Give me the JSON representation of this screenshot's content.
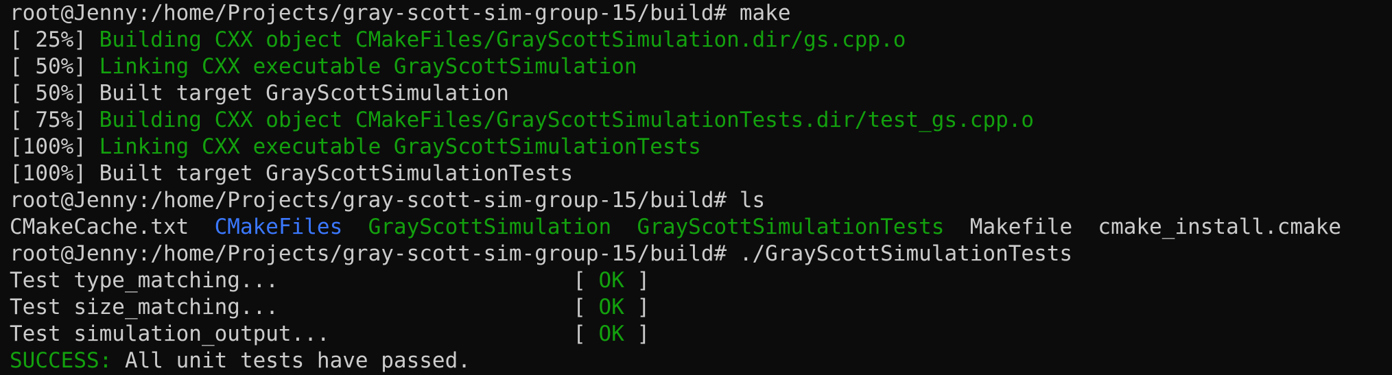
{
  "terminal": {
    "colors": {
      "background": "#0c0c0c",
      "foreground": "#cccccc",
      "green": "#13a10e",
      "blue": "#3b78ff"
    },
    "lines": [
      {
        "role": "prompt",
        "segments": [
          {
            "text": "root@Jenny:/home/Projects/gray-scott-sim-group-15/build# make",
            "color": "fg"
          }
        ]
      },
      {
        "role": "build-step",
        "segments": [
          {
            "text": "[ 25%] ",
            "color": "fg"
          },
          {
            "text": "Building CXX object CMakeFiles/GrayScottSimulation.dir/gs.cpp.o",
            "color": "green"
          }
        ]
      },
      {
        "role": "build-step",
        "segments": [
          {
            "text": "[ 50%] ",
            "color": "fg"
          },
          {
            "text": "Linking CXX executable GrayScottSimulation",
            "color": "green"
          }
        ]
      },
      {
        "role": "build-step",
        "segments": [
          {
            "text": "[ 50%] Built target GrayScottSimulation",
            "color": "fg"
          }
        ]
      },
      {
        "role": "build-step",
        "segments": [
          {
            "text": "[ 75%] ",
            "color": "fg"
          },
          {
            "text": "Building CXX object CMakeFiles/GrayScottSimulationTests.dir/test_gs.cpp.o",
            "color": "green"
          }
        ]
      },
      {
        "role": "build-step",
        "segments": [
          {
            "text": "[100%] ",
            "color": "fg"
          },
          {
            "text": "Linking CXX executable GrayScottSimulationTests",
            "color": "green"
          }
        ]
      },
      {
        "role": "build-step",
        "segments": [
          {
            "text": "[100%] Built target GrayScottSimulationTests",
            "color": "fg"
          }
        ]
      },
      {
        "role": "prompt",
        "segments": [
          {
            "text": "root@Jenny:/home/Projects/gray-scott-sim-group-15/build# ls",
            "color": "fg"
          }
        ]
      },
      {
        "role": "ls-output",
        "segments": [
          {
            "text": "CMakeCache.txt  ",
            "color": "fg"
          },
          {
            "text": "CMakeFiles",
            "color": "blue"
          },
          {
            "text": "  ",
            "color": "fg"
          },
          {
            "text": "GrayScottSimulation",
            "color": "green"
          },
          {
            "text": "  ",
            "color": "fg"
          },
          {
            "text": "GrayScottSimulationTests",
            "color": "green"
          },
          {
            "text": "  Makefile  cmake_install.cmake",
            "color": "fg"
          }
        ]
      },
      {
        "role": "prompt",
        "segments": [
          {
            "text": "root@Jenny:/home/Projects/gray-scott-sim-group-15/build# ./GrayScottSimulationTests",
            "color": "fg"
          }
        ]
      },
      {
        "role": "test-result",
        "segments": [
          {
            "text": "Test type_matching...                       [ ",
            "color": "fg"
          },
          {
            "text": "OK",
            "color": "green"
          },
          {
            "text": " ]",
            "color": "fg"
          }
        ]
      },
      {
        "role": "test-result",
        "segments": [
          {
            "text": "Test size_matching...                       [ ",
            "color": "fg"
          },
          {
            "text": "OK",
            "color": "green"
          },
          {
            "text": " ]",
            "color": "fg"
          }
        ]
      },
      {
        "role": "test-result",
        "segments": [
          {
            "text": "Test simulation_output...                   [ ",
            "color": "fg"
          },
          {
            "text": "OK",
            "color": "green"
          },
          {
            "text": " ]",
            "color": "fg"
          }
        ]
      },
      {
        "role": "summary",
        "segments": [
          {
            "text": "SUCCESS:",
            "color": "green"
          },
          {
            "text": " All unit tests have passed.",
            "color": "fg"
          }
        ]
      }
    ]
  }
}
